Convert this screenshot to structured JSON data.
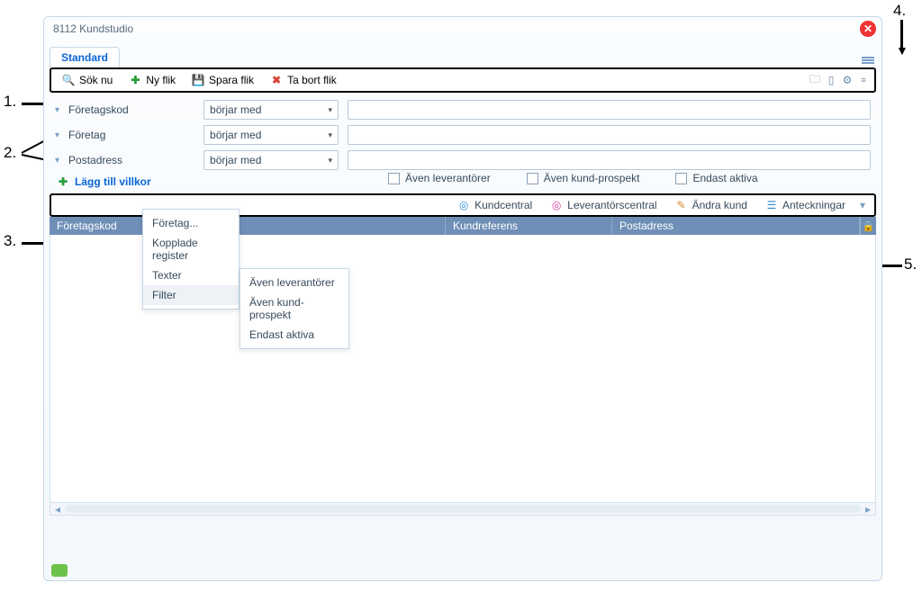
{
  "window": {
    "title": "8112 Kundstudio"
  },
  "tabs": {
    "active": "Standard"
  },
  "toolbar": {
    "search": "Sök nu",
    "newtab": "Ny flik",
    "savetab": "Spara flik",
    "deltab": "Ta bort flik"
  },
  "filters": {
    "rows": [
      {
        "label": "Företagskod",
        "op": "börjar med"
      },
      {
        "label": "Företag",
        "op": "börjar med"
      },
      {
        "label": "Postadress",
        "op": "börjar med"
      }
    ],
    "add": "Lägg till villkor"
  },
  "checks": {
    "c1": "Även leverantörer",
    "c2": "Även kund-prospekt",
    "c3": "Endast aktiva"
  },
  "toolbar2": {
    "b1": "Kundcentral",
    "b2": "Leverantörscentral",
    "b3": "Ändra kund",
    "b4": "Anteckningar"
  },
  "grid": {
    "cols": {
      "c1": "Företagskod",
      "c2": "Kundreferens",
      "c3": "Postadress"
    }
  },
  "menu1": {
    "m1": "Företag...",
    "m2": "Kopplade register",
    "m3": "Texter",
    "m4": "Filter"
  },
  "menu2": {
    "m1": "Även leverantörer",
    "m2": "Även kund-prospekt",
    "m3": "Endast aktiva"
  },
  "ann": {
    "a1": "1.",
    "a2": "2.",
    "a3": "3.",
    "a4": "4.",
    "a5": "5."
  }
}
